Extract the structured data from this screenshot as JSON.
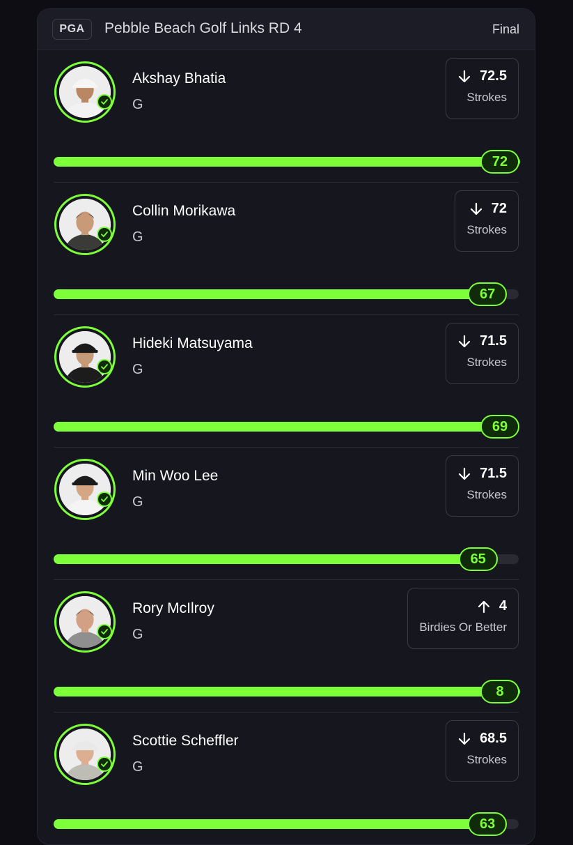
{
  "header": {
    "league": "PGA",
    "event": "Pebble Beach Golf Links RD 4",
    "status": "Final"
  },
  "colors": {
    "accent": "#7dff3a",
    "card_bg": "#16161f",
    "page_bg": "#0d0d13"
  },
  "picks": [
    {
      "name": "Akshay Bhatia",
      "position": "G",
      "direction": "down",
      "line": "72.5",
      "stat": "Strokes",
      "result": "72",
      "progress": 1.0,
      "avatar": "player-photo",
      "shirt": "#f2f2f2",
      "cap": "#f5f5f5",
      "skin": "#b98764",
      "hair": "#2a1d16"
    },
    {
      "name": "Collin Morikawa",
      "position": "G",
      "direction": "down",
      "line": "72",
      "stat": "Strokes",
      "result": "67",
      "progress": 0.93,
      "avatar": "player-photo",
      "shirt": "#3a3a36",
      "cap": null,
      "skin": "#c99a77",
      "hair": "#151515"
    },
    {
      "name": "Hideki Matsuyama",
      "position": "G",
      "direction": "down",
      "line": "71.5",
      "stat": "Strokes",
      "result": "69",
      "progress": 0.965,
      "avatar": "player-photo",
      "shirt": "#1c1c1c",
      "cap": "#1a1a1a",
      "skin": "#c49a78",
      "hair": "#101010"
    },
    {
      "name": "Min Woo Lee",
      "position": "G",
      "direction": "down",
      "line": "71.5",
      "stat": "Strokes",
      "result": "65",
      "progress": 0.91,
      "avatar": "player-photo",
      "shirt": "#f4f4f4",
      "cap": "#1b1b1b",
      "skin": "#d4a684",
      "hair": "#101010"
    },
    {
      "name": "Rory McIlroy",
      "position": "G",
      "direction": "up",
      "line": "4",
      "stat": "Birdies Or Better",
      "result": "8",
      "progress": 1.0,
      "avatar": "player-photo",
      "shirt": "#8f8f8f",
      "cap": null,
      "skin": "#d2a183",
      "hair": "#2b1f17"
    },
    {
      "name": "Scottie Scheffler",
      "position": "G",
      "direction": "down",
      "line": "68.5",
      "stat": "Strokes",
      "result": "63",
      "progress": 0.93,
      "avatar": "player-photo",
      "shirt": "#bdbdb5",
      "cap": "#e9e9e9",
      "skin": "#dcae92",
      "hair": "#7a5a3a"
    }
  ]
}
